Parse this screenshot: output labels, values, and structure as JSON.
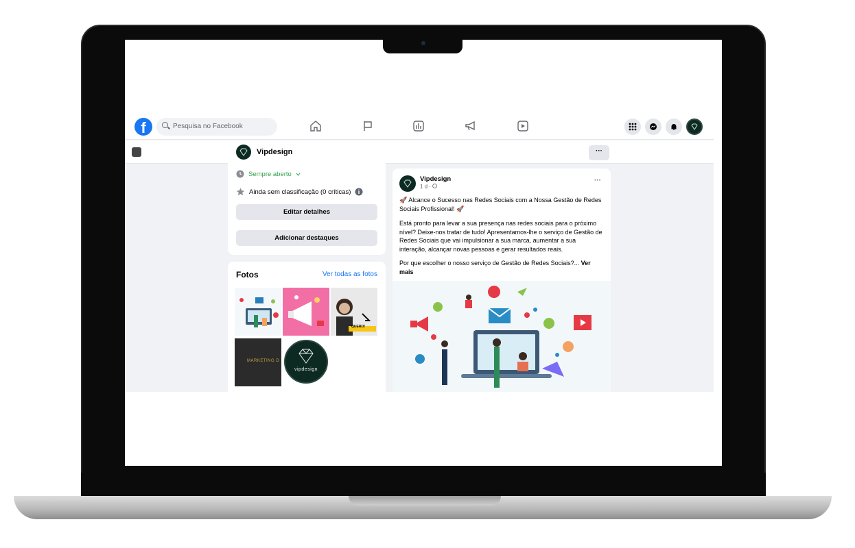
{
  "topnav": {
    "search_placeholder": "Pesquisa no Facebook",
    "logo": "f"
  },
  "pagebar": {
    "page_name": "Vipdesign",
    "more_label": "···"
  },
  "info": {
    "hours": "Sempre aberto",
    "rating": "Ainda sem classificação (0 críticas)",
    "edit_button": "Editar detalhes",
    "highlights_button": "Adicionar destaques"
  },
  "photos": {
    "title": "Fotos",
    "see_all": "Ver todas as fotos",
    "thumb4_text": "MARKETING D",
    "thumb5_text": "vipdesign",
    "thumb3_badge": "QUERO!"
  },
  "post": {
    "author": "Vipdesign",
    "time": "1 d · ",
    "more": "···",
    "headline": "🚀 Alcance o Sucesso nas Redes Sociais com a Nossa Gestão de Redes Sociais Profissional! 🚀",
    "body": "Está pronto para levar a sua presença nas redes sociais para o próximo nível? Deixe-nos tratar de tudo! Apresentamos-lhe o serviço de Gestão de Redes Sociais que vai impulsionar a sua marca, aumentar a sua interação, alcançar novas pessoas e gerar resultados reais.",
    "teaser": "Por que escolher o nosso serviço de Gestão de Redes Sociais?...",
    "see_more": "Ver mais"
  },
  "colors": {
    "facebook_blue": "#1877f2",
    "brand_dark_green": "#0d2a22",
    "open_green": "#31a24c"
  },
  "icons": [
    "search-icon",
    "home-icon",
    "flag-icon",
    "insights-icon",
    "megaphone-icon",
    "video-icon",
    "menu-grid-icon",
    "messenger-icon",
    "bell-icon",
    "clock-icon",
    "star-icon",
    "info-icon",
    "globe-icon"
  ]
}
